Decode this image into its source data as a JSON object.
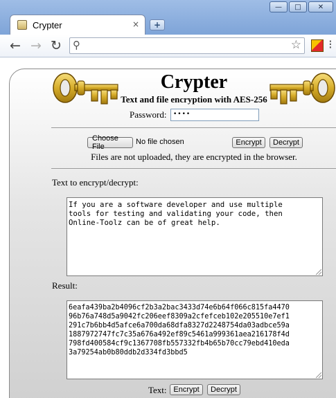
{
  "browser": {
    "tab_title": "Crypter",
    "tab_close": "×",
    "new_tab": "+",
    "back": "←",
    "forward": "→",
    "reload": "↻",
    "search_icon": "⚲",
    "star_icon": "☆",
    "wrench_icon": "⁝",
    "win_minimize": "—",
    "win_maximize": "□",
    "win_close": "✕",
    "colors": {
      "chrome": "#9fbde6",
      "tab": "#ffffff"
    }
  },
  "page": {
    "title": "Crypter",
    "subtitle": "Text and file encryption with AES-256",
    "password_label": "Password:",
    "password_value": "••••",
    "choose_file_label": "Choose File",
    "no_file_text": "No file chosen",
    "file_encrypt_label": "Encrypt",
    "file_decrypt_label": "Decrypt",
    "file_note": "Files are not uploaded, they are encrypted in the browser.",
    "input_label": "Text to encrypt/decrypt:",
    "input_text": "If you are a software developer and use multiple\ntools for testing and validating your code, then\nOnline-Toolz can be of great help.",
    "result_label": "Result:",
    "result_text": "6eafa439ba2b4096cf2b3a2bac3433d74e6b64f066c815fa4470\n96b76a748d5a9042fc206eef8309a2cfefceb102e205510e7ef1\n291c7b6bb4d5afce6a700da68dfa8327d2248754da03adbce59a\n1887972747fc7c35a676a492ef89c5461a999361aea216178f4d\n798fd400584cf9c1367708fb557332fb4b65b70cc79ebd410eda\n3a79254ab0b80ddb2d334fd3bbd5",
    "text_action_label": "Text:",
    "text_encrypt_label": "Encrypt",
    "text_decrypt_label": "Decrypt",
    "colors": {
      "key_gold": "#d7ad2a",
      "key_outline": "#6b4a00"
    }
  }
}
